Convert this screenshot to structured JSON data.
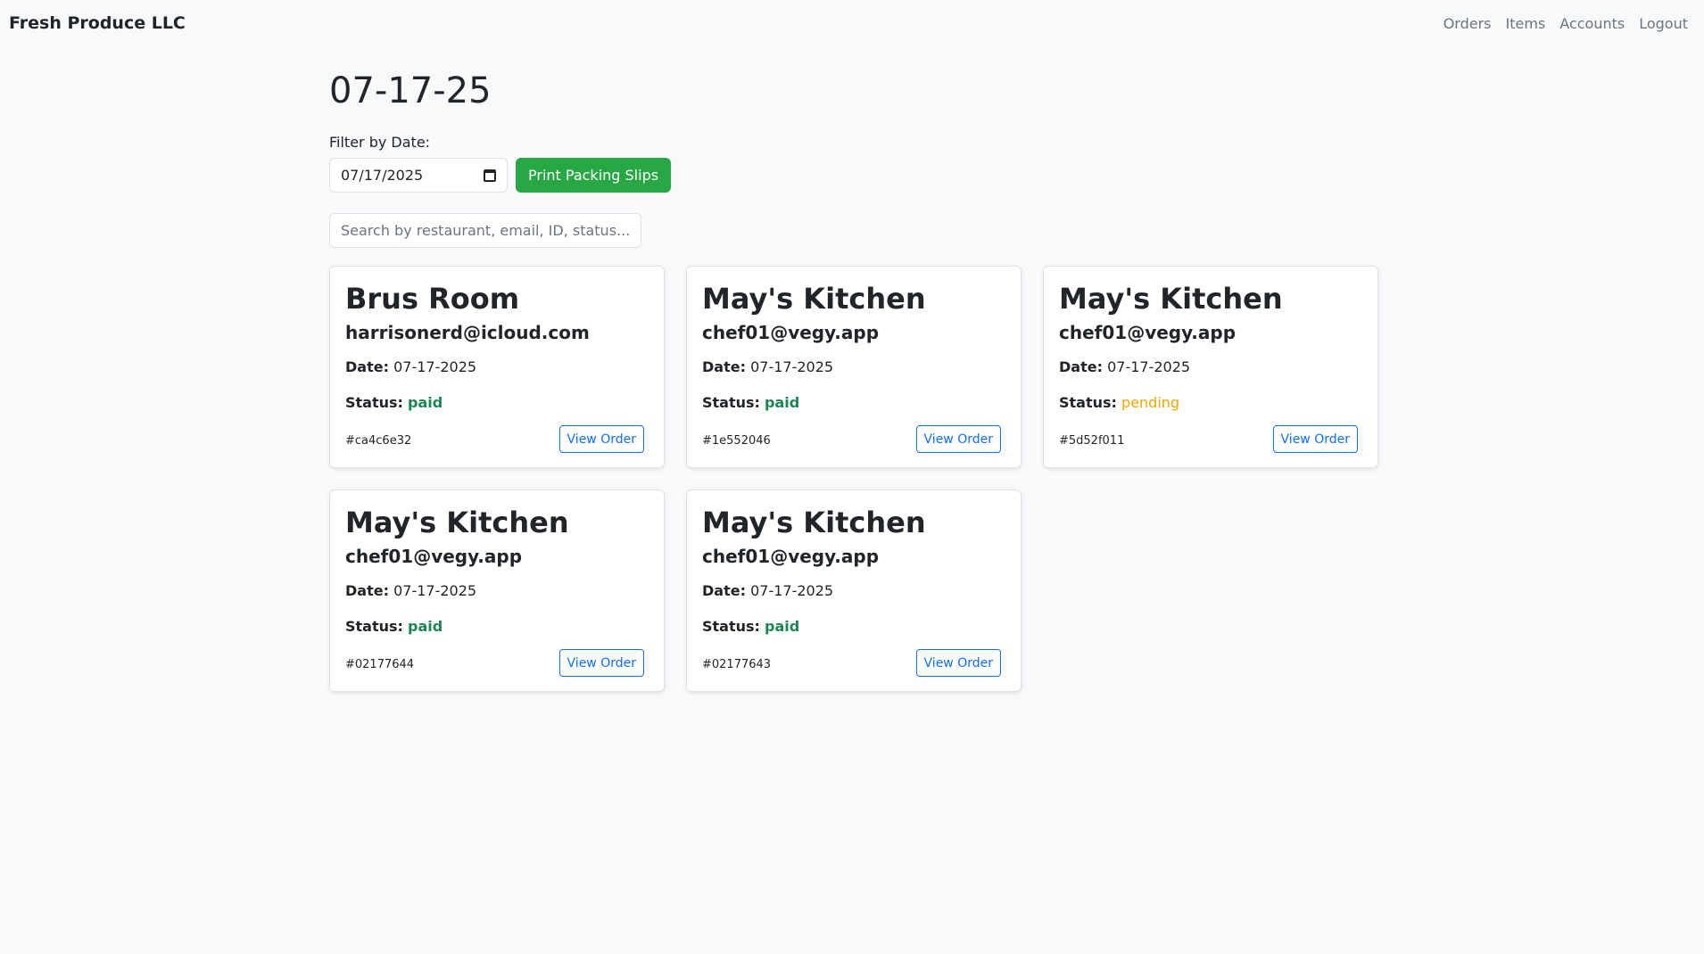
{
  "nav": {
    "brand": "Fresh Produce LLC",
    "links": [
      "Orders",
      "Items",
      "Accounts",
      "Logout"
    ]
  },
  "page": {
    "title": "07-17-25",
    "filter_label": "Filter by Date:",
    "date_value": "07/17/2025",
    "print_button": "Print Packing Slips",
    "search_placeholder": "Search by restaurant, email, ID, status..."
  },
  "labels": {
    "date": "Date:",
    "status": "Status:",
    "view_order": "View Order"
  },
  "colors": {
    "paid": "#198754",
    "pending": "#f0a500",
    "primary": "#0d6efd",
    "success": "#28a745"
  },
  "orders": [
    {
      "restaurant": "Brus Room",
      "email": "harrisonerd@icloud.com",
      "date": "07-17-2025",
      "status": "paid",
      "id": "#ca4c6e32"
    },
    {
      "restaurant": "May's Kitchen",
      "email": "chef01@vegy.app",
      "date": "07-17-2025",
      "status": "paid",
      "id": "#1e552046"
    },
    {
      "restaurant": "May's Kitchen",
      "email": "chef01@vegy.app",
      "date": "07-17-2025",
      "status": "pending",
      "id": "#5d52f011"
    },
    {
      "restaurant": "May's Kitchen",
      "email": "chef01@vegy.app",
      "date": "07-17-2025",
      "status": "paid",
      "id": "#02177644"
    },
    {
      "restaurant": "May's Kitchen",
      "email": "chef01@vegy.app",
      "date": "07-17-2025",
      "status": "paid",
      "id": "#02177643"
    }
  ]
}
